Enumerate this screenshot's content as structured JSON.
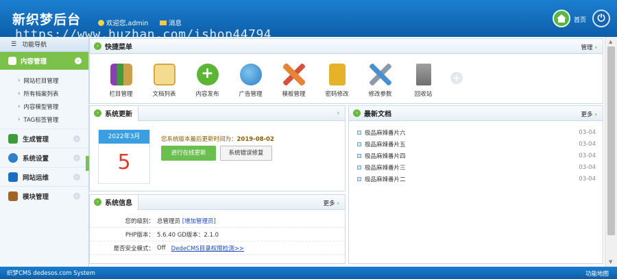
{
  "header": {
    "logo": "新织梦后台",
    "welcome": "欢迎您,admin",
    "message": "消息",
    "home": "首页"
  },
  "watermark": "https://www.huzhan.com/ishop44794",
  "sidebar": {
    "title": "功能导航",
    "active": "内容管理",
    "sub_items": [
      "网站栏目管理",
      "所有档案列表",
      "内容模型管理",
      "TAG标签管理"
    ],
    "items": [
      {
        "label": "生成管理",
        "color": "#3f9a3a"
      },
      {
        "label": "系统设置",
        "color": "#2f7fc9"
      },
      {
        "label": "网站运维",
        "color": "#1b6fc0"
      },
      {
        "label": "模块管理",
        "color": "#a0642a"
      }
    ]
  },
  "quick": {
    "title": "快捷菜单",
    "manage": "管理",
    "items": [
      {
        "label": "栏目管理",
        "icon": "books-icon",
        "color": "#8a3fae"
      },
      {
        "label": "文档列表",
        "icon": "notepad-icon",
        "color": "#e8c56a"
      },
      {
        "label": "内容发布",
        "icon": "plus-circle-icon",
        "color": "#5cb535"
      },
      {
        "label": "广告管理",
        "icon": "globe-icon",
        "color": "#3c96d8"
      },
      {
        "label": "模板管理",
        "icon": "pencil-ruler-icon",
        "color": "#e8843a"
      },
      {
        "label": "密码修改",
        "icon": "lock-icon",
        "color": "#e6b22a"
      },
      {
        "label": "修改参数",
        "icon": "tools-icon",
        "color": "#4a8fd0"
      },
      {
        "label": "回收站",
        "icon": "trash-icon",
        "color": "#8f8f8f"
      }
    ]
  },
  "update": {
    "title": "系统更新",
    "month": "2022年3月",
    "day": "5",
    "last_label": "您系统版本最后更新时间为：",
    "last_date": "2019-08-02",
    "online_btn": "进行在线更新",
    "repair_btn": "系统错误修复"
  },
  "docs": {
    "title": "最新文档",
    "more": "更多",
    "list": [
      {
        "title": "极品麻辣番片六",
        "date": "03-04"
      },
      {
        "title": "极品麻辣番片五",
        "date": "03-04"
      },
      {
        "title": "极品麻辣番片四",
        "date": "03-04"
      },
      {
        "title": "极品麻辣番片三",
        "date": "03-04"
      },
      {
        "title": "极品麻辣番片二",
        "date": "03-04"
      }
    ]
  },
  "sysinfo": {
    "title": "系统信息",
    "more": "更多",
    "rows": [
      {
        "k": "您的级别：",
        "v": "总管理员",
        "link": "[增加管理员]"
      },
      {
        "k": "PHP版本：",
        "v": "5.6.40   GD版本：2.1.0",
        "link": ""
      },
      {
        "k": "是否安全模式：",
        "v": "Off",
        "link": "DedeCMS目录权限检测>>"
      }
    ]
  },
  "footer": {
    "left": "织梦CMS  dedesos.com System",
    "right": "功能地图"
  }
}
